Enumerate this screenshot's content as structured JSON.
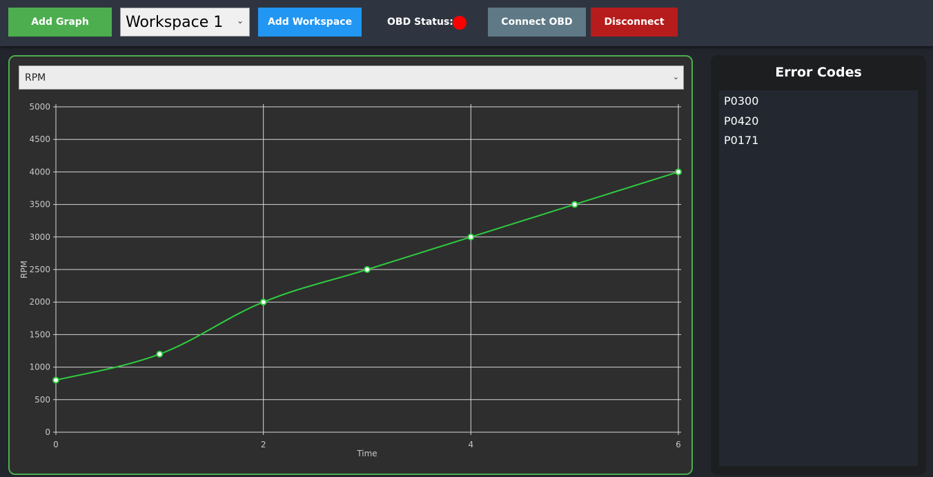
{
  "toolbar": {
    "add_graph_label": "Add Graph",
    "workspace_selected": "Workspace 1",
    "add_workspace_label": "Add Workspace",
    "obd_status_label": "OBD Status:",
    "obd_status_color": "#ff0000",
    "connect_label": "Connect OBD",
    "disconnect_label": "Disconnect"
  },
  "graph": {
    "metric_selected": "RPM",
    "accent_color": "#4cae4f"
  },
  "error_panel": {
    "title": "Error Codes",
    "codes": [
      "P0300",
      "P0420",
      "P0171"
    ]
  },
  "chart_data": {
    "type": "line",
    "xlabel": "Time",
    "ylabel": "RPM",
    "xlim": [
      0,
      6
    ],
    "ylim": [
      0,
      5000
    ],
    "x_ticks": [
      0,
      2,
      4,
      6
    ],
    "y_ticks": [
      0,
      500,
      1000,
      1500,
      2000,
      2500,
      3000,
      3500,
      4000,
      4500,
      5000
    ],
    "grid": true,
    "line_color": "#2ecc40",
    "series": [
      {
        "x": [
          0,
          1,
          2,
          3,
          4,
          5,
          6
        ],
        "values": [
          800,
          1200,
          2000,
          2500,
          3000,
          3500,
          4000
        ]
      }
    ]
  }
}
